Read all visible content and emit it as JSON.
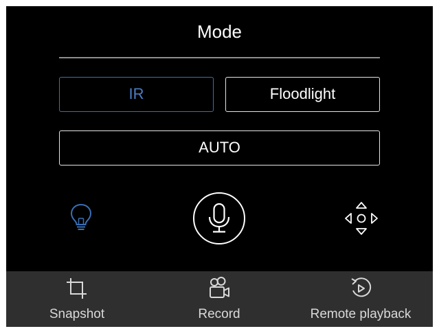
{
  "header": {
    "title": "Mode"
  },
  "modes": {
    "ir_label": "IR",
    "floodlight_label": "Floodlight",
    "auto_label": "AUTO",
    "selected": "IR"
  },
  "controls": {
    "light_icon": "lightbulb-icon",
    "talk_icon": "microphone-icon",
    "ptz_icon": "ptz-direction-icon"
  },
  "bottom_bar": {
    "items": [
      {
        "label": "Snapshot",
        "icon": "crop-icon"
      },
      {
        "label": "Record",
        "icon": "video-camera-icon"
      },
      {
        "label": "Remote playback",
        "icon": "playback-icon"
      }
    ]
  },
  "colors": {
    "background": "#000000",
    "accent": "#3a6fb6",
    "bar": "#2f2f2f",
    "text": "#ffffff"
  }
}
